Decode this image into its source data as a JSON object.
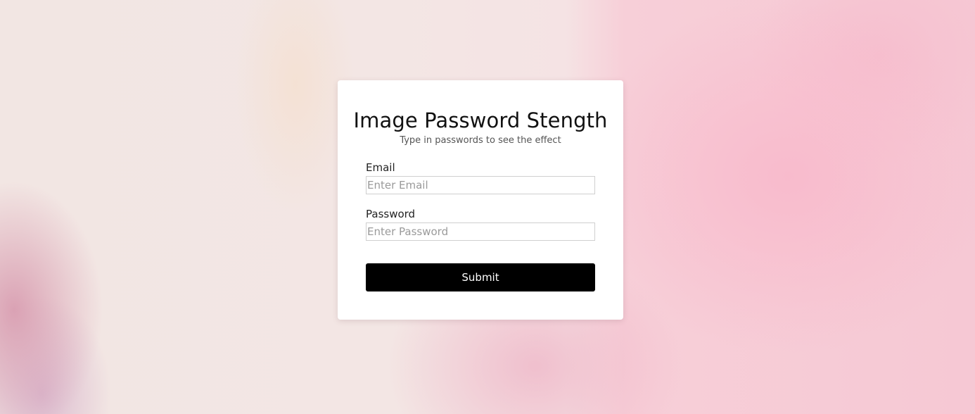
{
  "form": {
    "title": "Image Password Stength",
    "subtitle": "Type in passwords to see the effect",
    "email": {
      "label": "Email",
      "placeholder": "Enter Email",
      "value": ""
    },
    "password": {
      "label": "Password",
      "placeholder": "Enter Password",
      "value": ""
    },
    "submit_label": "Submit"
  },
  "colors": {
    "card_background": "#ffffff",
    "button_background": "#000000",
    "button_text": "#ffffff",
    "background_pink": "#f6c8d4",
    "background_cream": "#f2e6e3"
  }
}
